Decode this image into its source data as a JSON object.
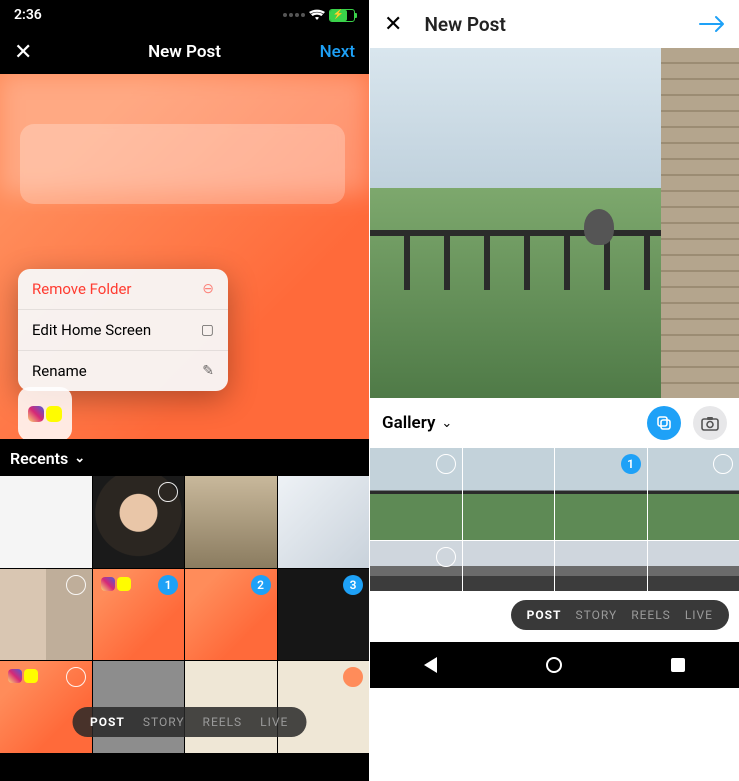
{
  "left": {
    "status": {
      "time": "2:36"
    },
    "nav": {
      "close": "✕",
      "title": "New Post",
      "next": "Next"
    },
    "context_menu": [
      {
        "label": "Remove Folder",
        "icon": "⊖",
        "danger": true
      },
      {
        "label": "Edit Home Screen",
        "icon": "▢",
        "danger": false
      },
      {
        "label": "Rename",
        "icon": "✎",
        "danger": false
      }
    ],
    "album": {
      "label": "Recents"
    },
    "thumbs": [
      {
        "sel": false,
        "badge": null
      },
      {
        "sel": true,
        "badge": null
      },
      {
        "sel": false,
        "badge": null
      },
      {
        "sel": false,
        "badge": null
      },
      {
        "sel": true,
        "badge": null
      },
      {
        "sel": false,
        "badge": "1"
      },
      {
        "sel": false,
        "badge": "2"
      },
      {
        "sel": false,
        "badge": "3"
      },
      {
        "sel": true,
        "badge": null
      },
      {
        "sel": false,
        "badge": null
      },
      {
        "sel": false,
        "badge": null
      },
      {
        "sel": true,
        "badge": null
      }
    ],
    "modes": {
      "post": "POST",
      "story": "STORY",
      "reels": "REELS",
      "live": "LIVE"
    }
  },
  "right": {
    "nav": {
      "close": "✕",
      "title": "New Post"
    },
    "album": {
      "label": "Gallery"
    },
    "thumbs": [
      {
        "sel": true,
        "badge": null
      },
      {
        "sel": false,
        "badge": null
      },
      {
        "sel": false,
        "badge": "1"
      },
      {
        "sel": true,
        "badge": null
      },
      {
        "sel": true,
        "badge": null
      },
      {
        "sel": false,
        "badge": null
      },
      {
        "sel": false,
        "badge": null
      },
      {
        "sel": false,
        "badge": null
      }
    ],
    "modes": {
      "post": "POST",
      "story": "STORY",
      "reels": "REELS",
      "live": "LIVE"
    }
  }
}
